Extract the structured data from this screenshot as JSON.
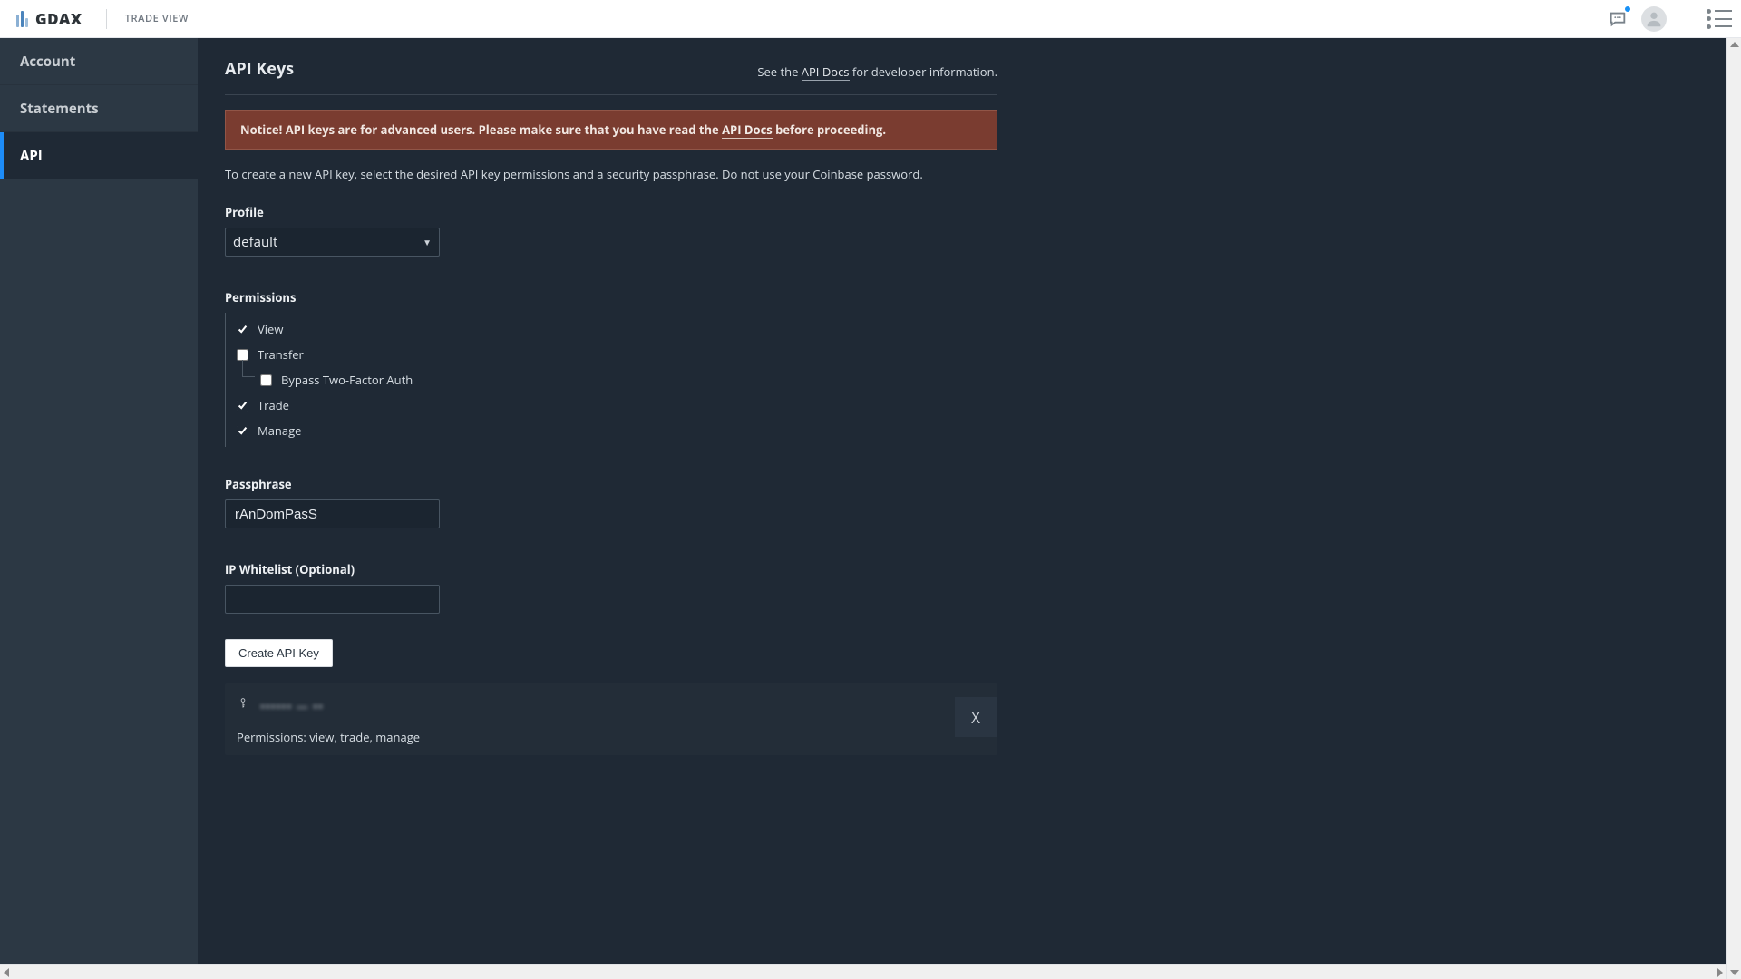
{
  "header": {
    "logo_text": "GDAX",
    "trade_view": "TRADE VIEW"
  },
  "sidebar": {
    "items": [
      {
        "label": "Account",
        "active": false
      },
      {
        "label": "Statements",
        "active": false
      },
      {
        "label": "API",
        "active": true
      }
    ]
  },
  "page": {
    "title": "API Keys",
    "api_docs_label": "API Docs",
    "top_hint_prefix": "See the ",
    "top_hint_suffix": " for developer information.",
    "notice_prefix": "Notice! API keys are for advanced users. Please make sure that you have read the ",
    "notice_suffix": " before proceeding.",
    "description": "To create a new API key, select the desired API key permissions and a security passphrase. Do not use your Coinbase password."
  },
  "profile": {
    "label": "Profile",
    "selected": "default"
  },
  "permissions": {
    "label": "Permissions",
    "items": [
      {
        "key": "view",
        "label": "View",
        "checked": true
      },
      {
        "key": "transfer",
        "label": "Transfer",
        "checked": false
      },
      {
        "key": "bypass_2fa",
        "label": "Bypass Two-Factor Auth",
        "checked": false,
        "sub": true
      },
      {
        "key": "trade",
        "label": "Trade",
        "checked": true
      },
      {
        "key": "manage",
        "label": "Manage",
        "checked": true
      }
    ]
  },
  "passphrase": {
    "label": "Passphrase",
    "value": "rAnDomPasS"
  },
  "whitelist": {
    "label": "IP Whitelist (Optional)",
    "value": ""
  },
  "create_button": "Create API Key",
  "existing_key": {
    "masked_label": "•••••• — ••",
    "perm_line": "Permissions: view, trade, manage",
    "delete_label": "X"
  }
}
